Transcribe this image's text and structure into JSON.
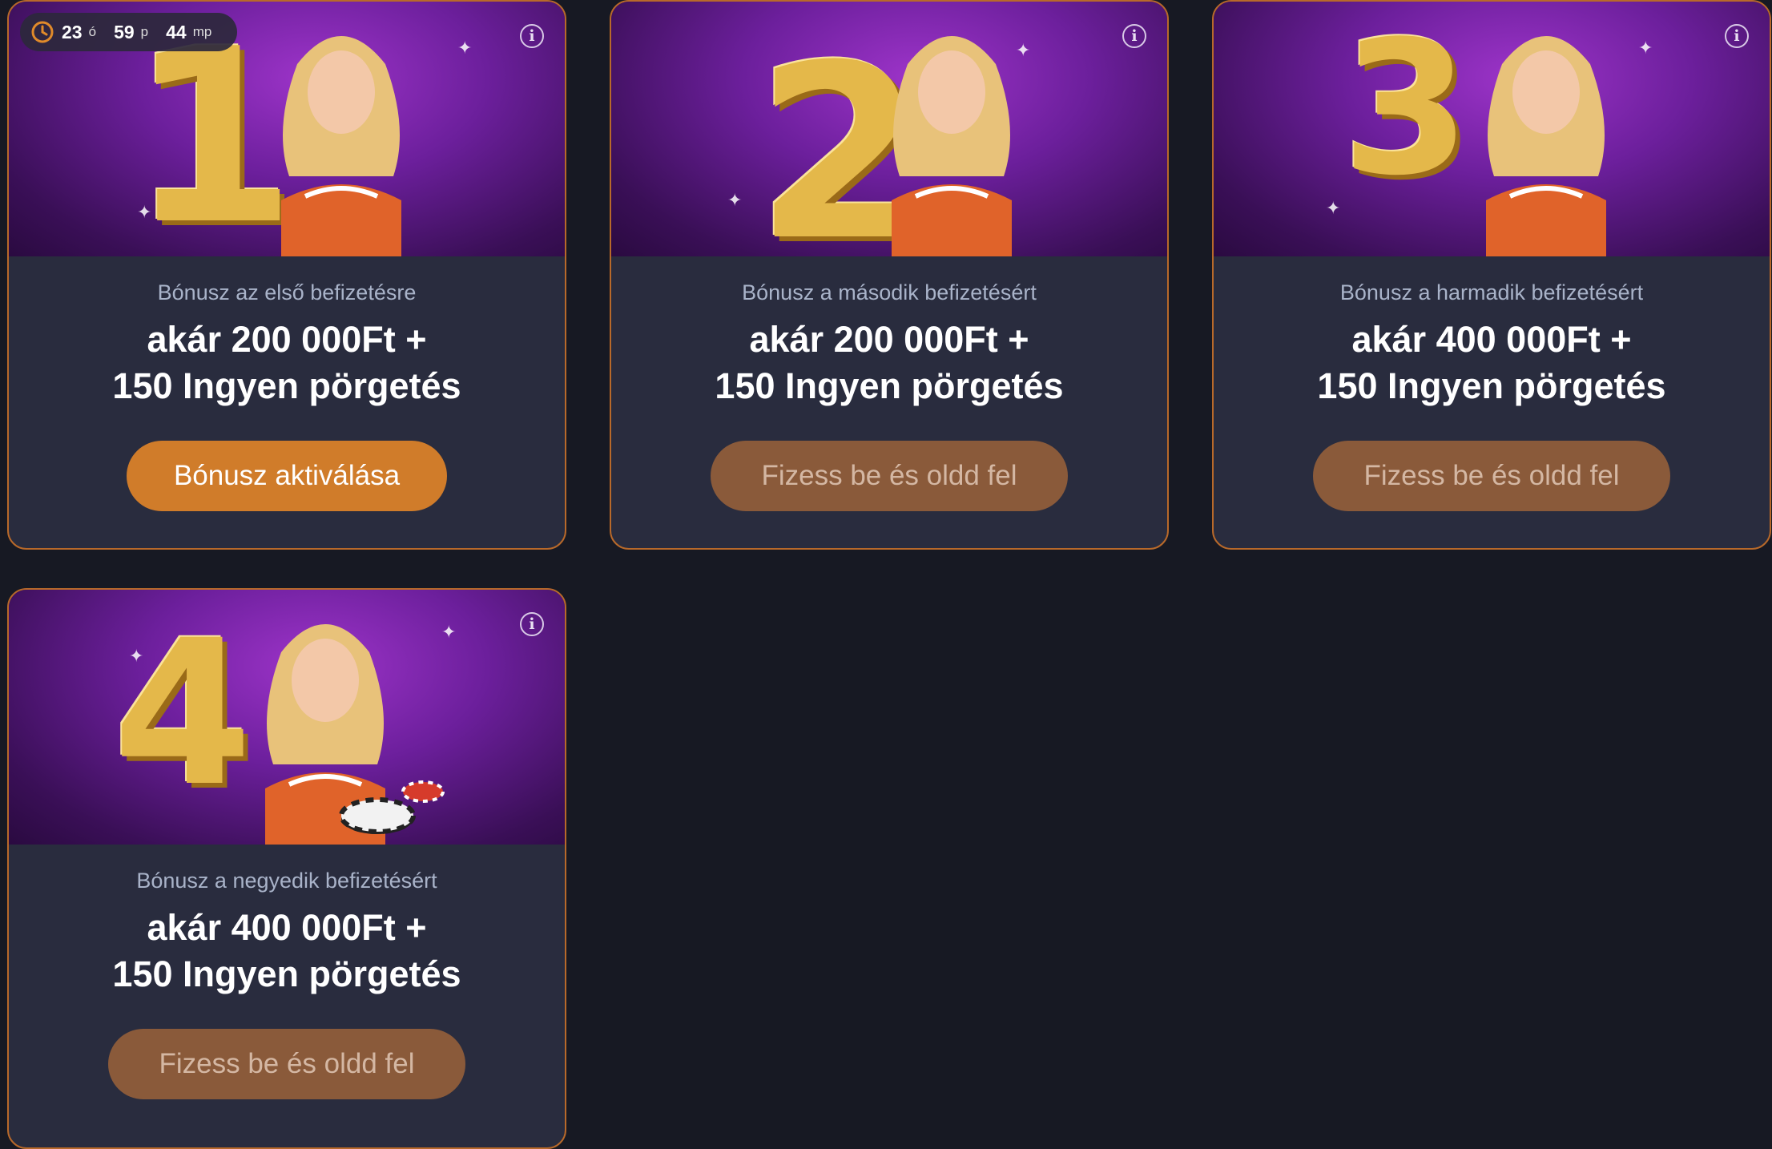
{
  "timer": {
    "hours": "23",
    "hours_unit": "ó",
    "minutes": "59",
    "minutes_unit": "p",
    "seconds": "44",
    "seconds_unit": "mp"
  },
  "cards": [
    {
      "number": "1",
      "subtitle": "Bónusz az első befizetésre",
      "line1": "akár 200 000Ft +",
      "line2": "150 Ingyen pörgetés",
      "button": "Bónusz aktiválása"
    },
    {
      "number": "2",
      "subtitle": "Bónusz a második befizetésért",
      "line1": "akár 200 000Ft +",
      "line2": "150 Ingyen pörgetés",
      "button": "Fizess be és oldd fel"
    },
    {
      "number": "3",
      "subtitle": "Bónusz a harmadik befizetésért",
      "line1": "akár 400 000Ft +",
      "line2": "150 Ingyen pörgetés",
      "button": "Fizess be és oldd fel"
    },
    {
      "number": "4",
      "subtitle": "Bónusz a negyedik befizetésért",
      "line1": "akár 400 000Ft +",
      "line2": "150 Ingyen pörgetés",
      "button": "Fizess be és oldd fel"
    }
  ],
  "info_glyph": "i",
  "colors": {
    "accent": "#d07c2a",
    "locked": "#8a5a3a",
    "card_bg": "#292c3e",
    "page_bg": "#171923",
    "border": "#b8692a"
  }
}
